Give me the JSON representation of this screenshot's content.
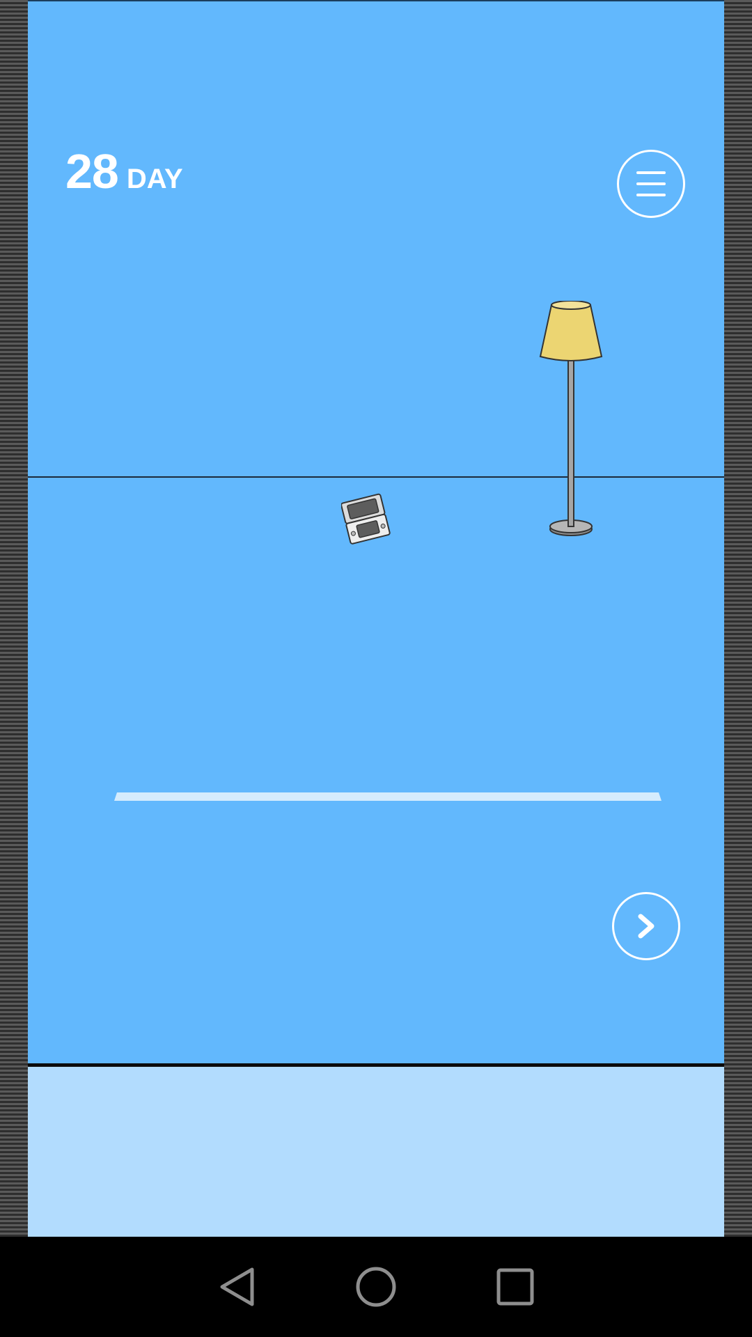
{
  "game": {
    "day_number": "28",
    "day_label": "DAY"
  },
  "colors": {
    "sky": "#62b8fd",
    "bottom_panel": "#b2dcfe",
    "lamp_shade": "#ecd572",
    "shelf": "#d5ecfd",
    "nav_icons": "#8e8e8e"
  },
  "icons": {
    "menu": "hamburger-icon",
    "next": "chevron-right-icon",
    "nav_back": "triangle-back-icon",
    "nav_home": "circle-home-icon",
    "nav_recents": "square-recents-icon"
  }
}
